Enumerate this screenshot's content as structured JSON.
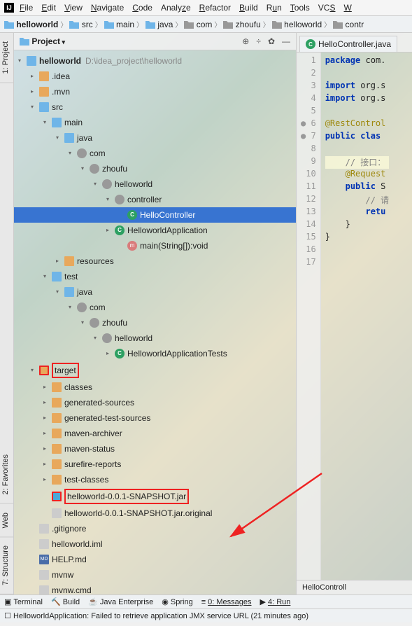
{
  "menu": [
    "File",
    "Edit",
    "View",
    "Navigate",
    "Code",
    "Analyze",
    "Refactor",
    "Build",
    "Run",
    "Tools",
    "VCS",
    "W"
  ],
  "breadcrumb": [
    "helloworld",
    "src",
    "main",
    "java",
    "com",
    "zhoufu",
    "helloworld",
    "contr"
  ],
  "panel": {
    "title": "Project",
    "icons": [
      "target-icon",
      "collapse-icon",
      "gear-icon",
      "hide-icon"
    ]
  },
  "tree": {
    "root": {
      "label": "helloworld",
      "path": "D:\\idea_project\\helloworld"
    },
    "idea": ".idea",
    "mvn": ".mvn",
    "src": "src",
    "main": "main",
    "java": "java",
    "com": "com",
    "zhoufu": "zhoufu",
    "hw": "helloworld",
    "controller": "controller",
    "hello_ctrl": "HelloController",
    "hw_app": "HelloworldApplication",
    "main_method": "main(String[]):void",
    "resources": "resources",
    "test": "test",
    "t_java": "java",
    "t_com": "com",
    "t_zhoufu": "zhoufu",
    "t_hw": "helloworld",
    "hw_app_tests": "HelloworldApplicationTests",
    "target": "target",
    "classes": "classes",
    "gen_src": "generated-sources",
    "gen_test_src": "generated-test-sources",
    "mvn_arch": "maven-archiver",
    "mvn_status": "maven-status",
    "surefire": "surefire-reports",
    "test_classes": "test-classes",
    "jar": "helloworld-0.0.1-SNAPSHOT.jar",
    "jar_orig": "helloworld-0.0.1-SNAPSHOT.jar.original",
    "gitignore": ".gitignore",
    "iml": "helloworld.iml",
    "help_md": "HELP.md",
    "mvnw": "mvnw",
    "mvnw_cmd": "mvnw.cmd"
  },
  "editor": {
    "tab": "HelloController.java",
    "lines": [
      {
        "n": 1,
        "html": "<span class='kw'>package</span> com."
      },
      {
        "n": 2,
        "html": ""
      },
      {
        "n": 3,
        "html": "<span class='kw'>import</span> org.s"
      },
      {
        "n": 4,
        "html": "<span class='kw'>import</span> org.s"
      },
      {
        "n": 5,
        "html": ""
      },
      {
        "n": 6,
        "html": "<span class='ann'>@RestControl</span>",
        "gutter": "●"
      },
      {
        "n": 7,
        "html": "<span class='kw'>public</span> <span class='kw'>clas</span>",
        "gutter": "●"
      },
      {
        "n": 8,
        "html": ""
      },
      {
        "n": 9,
        "html": "    <span class='cmt'>// 接口：</span>",
        "hl": true
      },
      {
        "n": 10,
        "html": "    <span class='ann'>@Request</span>"
      },
      {
        "n": 11,
        "html": "    <span class='kw'>public</span> S"
      },
      {
        "n": 12,
        "html": "        <span class='cmt'>// 请</span>"
      },
      {
        "n": 13,
        "html": "        <span class='kw'>retu</span>"
      },
      {
        "n": 14,
        "html": "    }"
      },
      {
        "n": 15,
        "html": "}"
      },
      {
        "n": 16,
        "html": ""
      },
      {
        "n": 17,
        "html": ""
      }
    ],
    "crumb": "HelloControll"
  },
  "toolbar": {
    "terminal": "Terminal",
    "build": "Build",
    "java_ent": "Java Enterprise",
    "spring": "Spring",
    "messages": "0: Messages",
    "run": "4: Run"
  },
  "status": "HelloworldApplication: Failed to retrieve application JMX service URL (21 minutes ago)",
  "side_tabs": {
    "project": "1: Project",
    "structure": "7: Structure",
    "web": "Web",
    "favorites": "2: Favorites"
  }
}
